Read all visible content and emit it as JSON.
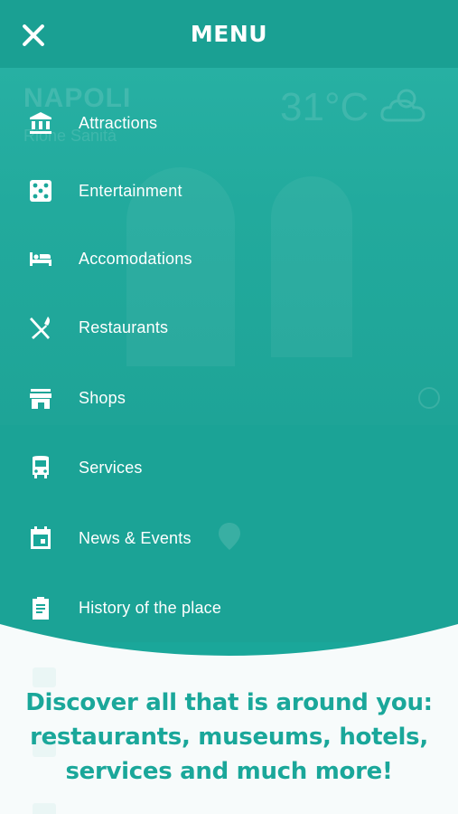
{
  "header": {
    "title": "MENU",
    "close_icon": "close-icon"
  },
  "menu": {
    "items": [
      {
        "label": "Attractions",
        "icon": "museum-icon"
      },
      {
        "label": "Entertainment",
        "icon": "dice-icon"
      },
      {
        "label": "Accomodations",
        "icon": "bed-icon"
      },
      {
        "label": "Restaurants",
        "icon": "fork-knife-icon"
      },
      {
        "label": "Shops",
        "icon": "store-icon"
      },
      {
        "label": "Services",
        "icon": "bus-icon"
      },
      {
        "label": "News & Events",
        "icon": "calendar-icon"
      },
      {
        "label": "History of the place",
        "icon": "clipboard-icon"
      }
    ]
  },
  "background": {
    "city": "NAPOLI",
    "district": "Rione Sanità",
    "temperature": "31°C"
  },
  "promo": {
    "line1": "Discover all that is around you:",
    "line2": "restaurants, museums, hotels,",
    "line3": "services and much more!"
  },
  "colors": {
    "accent": "#1aa79a",
    "header": "#1aa093",
    "text_light": "#ffffff"
  }
}
